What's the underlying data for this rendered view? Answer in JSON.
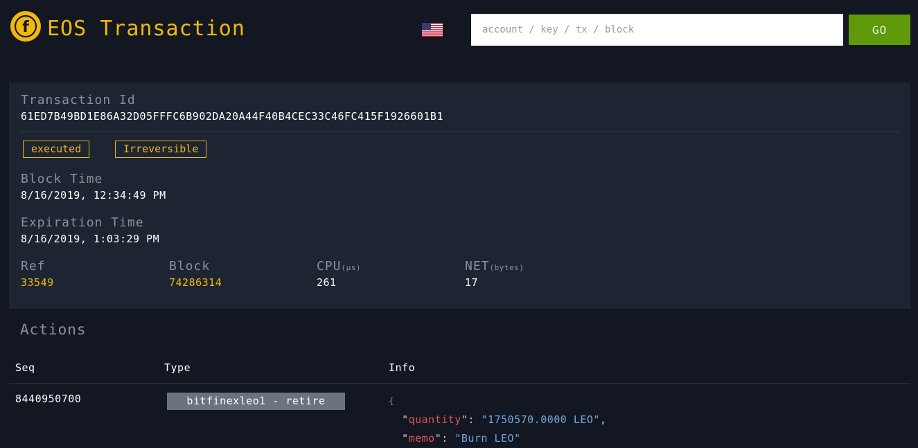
{
  "header": {
    "title": "EOS Transaction",
    "search_placeholder": "account / key / tx / block",
    "go_label": "GO"
  },
  "transaction": {
    "id_label": "Transaction Id",
    "id": "61ED7B49BD1E86A32D05FFFC6B902DA20A44F40B4CEC33C46FC415F1926601B1",
    "status_badges": [
      "executed",
      "Irreversible"
    ],
    "block_time_label": "Block Time",
    "block_time": "8/16/2019, 12:34:49 PM",
    "expiration_label": "Expiration Time",
    "expiration": "8/16/2019, 1:03:29 PM",
    "stats": {
      "ref_label": "Ref",
      "ref": "33549",
      "block_label": "Block",
      "block": "74286314",
      "cpu_label": "CPU",
      "cpu_unit": "(µs)",
      "cpu": "261",
      "net_label": "NET",
      "net_unit": "(bytes)",
      "net": "17"
    }
  },
  "actions": {
    "title": "Actions",
    "columns": [
      "Seq",
      "Type",
      "Info"
    ],
    "rows": [
      {
        "seq": "8440950700",
        "type": "bitfinexleo1 - retire",
        "info": {
          "open": "{",
          "quantity_key": "quantity",
          "quantity": "1750570.0000 LEO",
          "memo_key": "memo",
          "memo": "Burn LEO"
        }
      }
    ]
  },
  "colors": {
    "background": "#131722",
    "panel": "#1e2532",
    "accent": "#f0b90b",
    "go_button": "#5f9a0a"
  }
}
